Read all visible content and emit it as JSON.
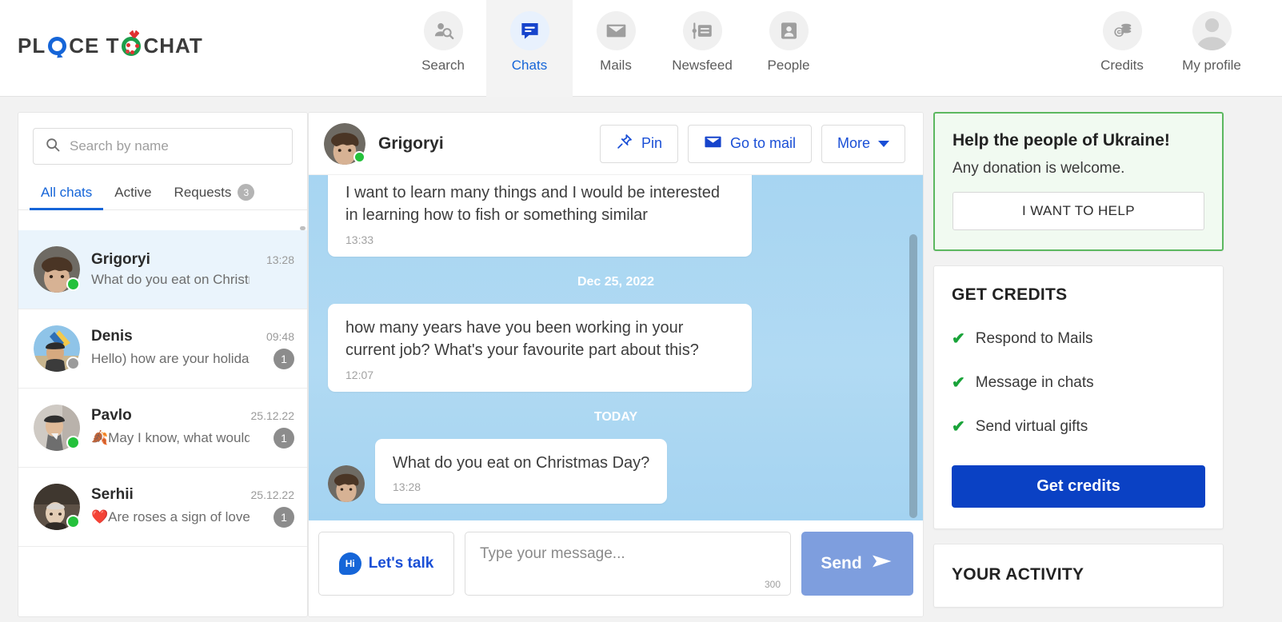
{
  "brand": {
    "logo_part1": "PL",
    "logo_part2": "CE T",
    "logo_part3": " CHAT"
  },
  "nav": {
    "items": [
      {
        "label": "Search",
        "icon": "user-search-icon",
        "active": false
      },
      {
        "label": "Chats",
        "icon": "chat-bubble-icon",
        "active": true
      },
      {
        "label": "Mails",
        "icon": "envelope-icon",
        "active": false
      },
      {
        "label": "Newsfeed",
        "icon": "newsfeed-icon",
        "active": false
      },
      {
        "label": "People",
        "icon": "contact-card-icon",
        "active": false
      }
    ],
    "right_items": [
      {
        "label": "Credits",
        "icon": "coins-icon"
      },
      {
        "label": "My profile",
        "icon": "avatar-icon"
      }
    ],
    "accent_color": "#1565d8"
  },
  "sidebar": {
    "search": {
      "placeholder": "Search by name",
      "value": ""
    },
    "tabs": [
      {
        "label": "All chats",
        "active": true,
        "badge": ""
      },
      {
        "label": "Active",
        "active": false,
        "badge": ""
      },
      {
        "label": "Requests",
        "active": false,
        "badge": "3"
      }
    ],
    "chats": [
      {
        "name": "Grigoryi",
        "time": "13:28",
        "preview": "What do you eat on Christm",
        "emoji": "",
        "status": "online",
        "badge": "",
        "selected": true
      },
      {
        "name": "Denis",
        "time": "09:48",
        "preview": "Hello) how are your holiday",
        "emoji": "",
        "status": "offline",
        "badge": "1",
        "selected": false
      },
      {
        "name": "Pavlo",
        "time": "25.12.22",
        "preview": "May I know, what would",
        "emoji": "🍂",
        "status": "online",
        "badge": "1",
        "selected": false
      },
      {
        "name": "Serhii",
        "time": "25.12.22",
        "preview": "Are roses a sign of love?",
        "emoji": "❤️",
        "status": "online",
        "badge": "1",
        "selected": false
      }
    ]
  },
  "conversation": {
    "contact_name": "Grigoryi",
    "contact_status": "online",
    "actions": [
      {
        "label": "Pin",
        "icon": "pin-icon"
      },
      {
        "label": "Go to mail",
        "icon": "envelope-icon"
      },
      {
        "label": "More",
        "icon": "chevron-down-icon"
      }
    ],
    "messages": [
      {
        "kind": "bubble",
        "text": "I want to learn many things and I would be interested in learning how to fish or something similar",
        "time": "13:33",
        "clipped": true,
        "avatar": false
      },
      {
        "kind": "divider",
        "text": "Dec 25, 2022"
      },
      {
        "kind": "bubble",
        "text": "how many years have you been working in your current job? What's your favourite part about this?",
        "time": "12:07",
        "clipped": false,
        "avatar": false
      },
      {
        "kind": "divider",
        "text": "TODAY"
      },
      {
        "kind": "bubble",
        "text": "What do you eat on Christmas Day?",
        "time": "13:28",
        "clipped": false,
        "avatar": true
      }
    ],
    "composer": {
      "lets_talk_label": "Let's talk",
      "lets_talk_icon_text": "Hi",
      "input_placeholder": "Type your message...",
      "input_value": "",
      "char_counter": "300",
      "send_label": "Send"
    }
  },
  "right_panel": {
    "ukraine": {
      "title": "Help the people of Ukraine!",
      "subtitle": "Any donation is welcome.",
      "button_label": "I WANT TO HELP",
      "accent_color": "#5cb860"
    },
    "credits": {
      "title": "GET CREDITS",
      "items": [
        "Respond to Mails",
        "Message in chats",
        "Send virtual gifts"
      ],
      "button_label": "Get credits",
      "button_color": "#0a41c4"
    },
    "activity": {
      "title": "YOUR ACTIVITY"
    }
  }
}
